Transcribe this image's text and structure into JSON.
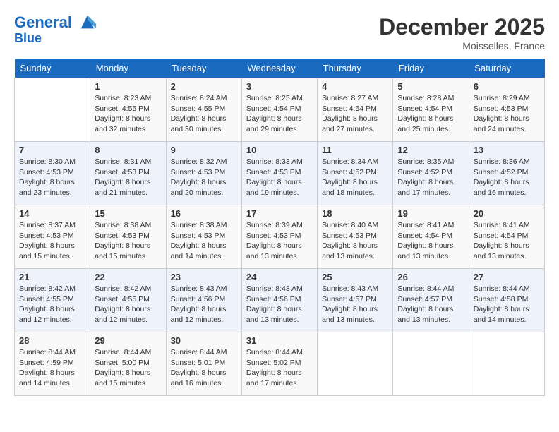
{
  "header": {
    "logo_line1": "General",
    "logo_line2": "Blue",
    "month": "December 2025",
    "location": "Moisselles, France"
  },
  "weekdays": [
    "Sunday",
    "Monday",
    "Tuesday",
    "Wednesday",
    "Thursday",
    "Friday",
    "Saturday"
  ],
  "weeks": [
    [
      {
        "day": "",
        "info": ""
      },
      {
        "day": "1",
        "info": "Sunrise: 8:23 AM\nSunset: 4:55 PM\nDaylight: 8 hours\nand 32 minutes."
      },
      {
        "day": "2",
        "info": "Sunrise: 8:24 AM\nSunset: 4:55 PM\nDaylight: 8 hours\nand 30 minutes."
      },
      {
        "day": "3",
        "info": "Sunrise: 8:25 AM\nSunset: 4:54 PM\nDaylight: 8 hours\nand 29 minutes."
      },
      {
        "day": "4",
        "info": "Sunrise: 8:27 AM\nSunset: 4:54 PM\nDaylight: 8 hours\nand 27 minutes."
      },
      {
        "day": "5",
        "info": "Sunrise: 8:28 AM\nSunset: 4:54 PM\nDaylight: 8 hours\nand 25 minutes."
      },
      {
        "day": "6",
        "info": "Sunrise: 8:29 AM\nSunset: 4:53 PM\nDaylight: 8 hours\nand 24 minutes."
      }
    ],
    [
      {
        "day": "7",
        "info": "Sunrise: 8:30 AM\nSunset: 4:53 PM\nDaylight: 8 hours\nand 23 minutes."
      },
      {
        "day": "8",
        "info": "Sunrise: 8:31 AM\nSunset: 4:53 PM\nDaylight: 8 hours\nand 21 minutes."
      },
      {
        "day": "9",
        "info": "Sunrise: 8:32 AM\nSunset: 4:53 PM\nDaylight: 8 hours\nand 20 minutes."
      },
      {
        "day": "10",
        "info": "Sunrise: 8:33 AM\nSunset: 4:53 PM\nDaylight: 8 hours\nand 19 minutes."
      },
      {
        "day": "11",
        "info": "Sunrise: 8:34 AM\nSunset: 4:52 PM\nDaylight: 8 hours\nand 18 minutes."
      },
      {
        "day": "12",
        "info": "Sunrise: 8:35 AM\nSunset: 4:52 PM\nDaylight: 8 hours\nand 17 minutes."
      },
      {
        "day": "13",
        "info": "Sunrise: 8:36 AM\nSunset: 4:52 PM\nDaylight: 8 hours\nand 16 minutes."
      }
    ],
    [
      {
        "day": "14",
        "info": "Sunrise: 8:37 AM\nSunset: 4:53 PM\nDaylight: 8 hours\nand 15 minutes."
      },
      {
        "day": "15",
        "info": "Sunrise: 8:38 AM\nSunset: 4:53 PM\nDaylight: 8 hours\nand 15 minutes."
      },
      {
        "day": "16",
        "info": "Sunrise: 8:38 AM\nSunset: 4:53 PM\nDaylight: 8 hours\nand 14 minutes."
      },
      {
        "day": "17",
        "info": "Sunrise: 8:39 AM\nSunset: 4:53 PM\nDaylight: 8 hours\nand 13 minutes."
      },
      {
        "day": "18",
        "info": "Sunrise: 8:40 AM\nSunset: 4:53 PM\nDaylight: 8 hours\nand 13 minutes."
      },
      {
        "day": "19",
        "info": "Sunrise: 8:41 AM\nSunset: 4:54 PM\nDaylight: 8 hours\nand 13 minutes."
      },
      {
        "day": "20",
        "info": "Sunrise: 8:41 AM\nSunset: 4:54 PM\nDaylight: 8 hours\nand 13 minutes."
      }
    ],
    [
      {
        "day": "21",
        "info": "Sunrise: 8:42 AM\nSunset: 4:55 PM\nDaylight: 8 hours\nand 12 minutes."
      },
      {
        "day": "22",
        "info": "Sunrise: 8:42 AM\nSunset: 4:55 PM\nDaylight: 8 hours\nand 12 minutes."
      },
      {
        "day": "23",
        "info": "Sunrise: 8:43 AM\nSunset: 4:56 PM\nDaylight: 8 hours\nand 12 minutes."
      },
      {
        "day": "24",
        "info": "Sunrise: 8:43 AM\nSunset: 4:56 PM\nDaylight: 8 hours\nand 13 minutes."
      },
      {
        "day": "25",
        "info": "Sunrise: 8:43 AM\nSunset: 4:57 PM\nDaylight: 8 hours\nand 13 minutes."
      },
      {
        "day": "26",
        "info": "Sunrise: 8:44 AM\nSunset: 4:57 PM\nDaylight: 8 hours\nand 13 minutes."
      },
      {
        "day": "27",
        "info": "Sunrise: 8:44 AM\nSunset: 4:58 PM\nDaylight: 8 hours\nand 14 minutes."
      }
    ],
    [
      {
        "day": "28",
        "info": "Sunrise: 8:44 AM\nSunset: 4:59 PM\nDaylight: 8 hours\nand 14 minutes."
      },
      {
        "day": "29",
        "info": "Sunrise: 8:44 AM\nSunset: 5:00 PM\nDaylight: 8 hours\nand 15 minutes."
      },
      {
        "day": "30",
        "info": "Sunrise: 8:44 AM\nSunset: 5:01 PM\nDaylight: 8 hours\nand 16 minutes."
      },
      {
        "day": "31",
        "info": "Sunrise: 8:44 AM\nSunset: 5:02 PM\nDaylight: 8 hours\nand 17 minutes."
      },
      {
        "day": "",
        "info": ""
      },
      {
        "day": "",
        "info": ""
      },
      {
        "day": "",
        "info": ""
      }
    ]
  ]
}
